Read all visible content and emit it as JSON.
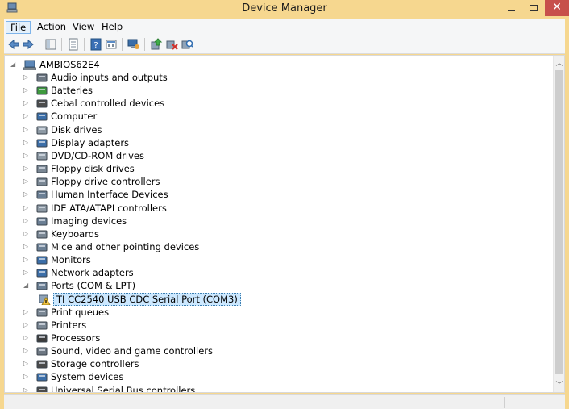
{
  "window": {
    "title": "Device Manager",
    "accent": "#f6d78f",
    "close_symbol": "✕"
  },
  "menu": [
    "File",
    "Action",
    "View",
    "Help"
  ],
  "toolbar": {
    "buttons": [
      "back-icon",
      "forward-icon",
      "show-hide-tree-icon",
      "properties-icon",
      "help-icon",
      "view-icon",
      "monitor-icon",
      "update-driver-icon",
      "disable-device-icon",
      "scan-hardware-icon"
    ]
  },
  "tree": {
    "root": "AMBIOS62E4",
    "items": [
      {
        "label": "Audio inputs and outputs",
        "icon": "speaker-icon",
        "expanded": false
      },
      {
        "label": "Batteries",
        "icon": "battery-icon",
        "expanded": false
      },
      {
        "label": "Cebal controlled devices",
        "icon": "usb-device-icon",
        "expanded": false
      },
      {
        "label": "Computer",
        "icon": "computer-icon",
        "expanded": false
      },
      {
        "label": "Disk drives",
        "icon": "disk-drive-icon",
        "expanded": false
      },
      {
        "label": "Display adapters",
        "icon": "display-adapter-icon",
        "expanded": false
      },
      {
        "label": "DVD/CD-ROM drives",
        "icon": "dvd-drive-icon",
        "expanded": false
      },
      {
        "label": "Floppy disk drives",
        "icon": "floppy-disk-icon",
        "expanded": false
      },
      {
        "label": "Floppy drive controllers",
        "icon": "floppy-controller-icon",
        "expanded": false
      },
      {
        "label": "Human Interface Devices",
        "icon": "hid-icon",
        "expanded": false
      },
      {
        "label": "IDE ATA/ATAPI controllers",
        "icon": "ide-controller-icon",
        "expanded": false
      },
      {
        "label": "Imaging devices",
        "icon": "imaging-device-icon",
        "expanded": false
      },
      {
        "label": "Keyboards",
        "icon": "keyboard-icon",
        "expanded": false
      },
      {
        "label": "Mice and other pointing devices",
        "icon": "mouse-icon",
        "expanded": false
      },
      {
        "label": "Monitors",
        "icon": "monitor-icon",
        "expanded": false
      },
      {
        "label": "Network adapters",
        "icon": "network-adapter-icon",
        "expanded": false
      },
      {
        "label": "Ports (COM & LPT)",
        "icon": "port-icon",
        "expanded": true
      },
      {
        "label": "TI CC2540 USB CDC Serial Port (COM3)",
        "icon": "warning-device-icon",
        "child": true,
        "selected": true
      },
      {
        "label": "Print queues",
        "icon": "print-queue-icon",
        "expanded": false
      },
      {
        "label": "Printers",
        "icon": "printer-icon",
        "expanded": false
      },
      {
        "label": "Processors",
        "icon": "processor-icon",
        "expanded": false
      },
      {
        "label": "Sound, video and game controllers",
        "icon": "sound-controller-icon",
        "expanded": false
      },
      {
        "label": "Storage controllers",
        "icon": "storage-controller-icon",
        "expanded": false
      },
      {
        "label": "System devices",
        "icon": "system-device-icon",
        "expanded": false
      },
      {
        "label": "Universal Serial Bus controllers",
        "icon": "usb-controller-icon",
        "expanded": false
      }
    ]
  },
  "colors": {
    "selection_bg": "#cce8ff",
    "selection_border": "#3c7fb1",
    "warning": "#f4c542"
  }
}
